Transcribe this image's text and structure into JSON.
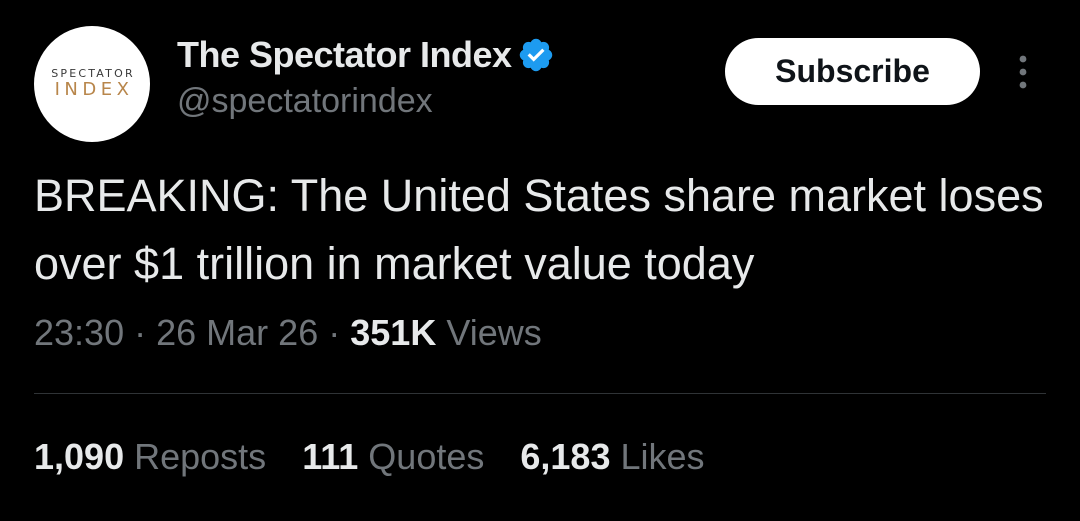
{
  "profile": {
    "avatar_line1": "SPECTATOR",
    "avatar_line2": "INDEX",
    "display_name": "The Spectator Index",
    "handle": "@spectatorindex",
    "verified": true
  },
  "actions": {
    "subscribe_label": "Subscribe",
    "more_icon": "more-vertical-icon"
  },
  "tweet": {
    "text": "BREAKING: The United States share market loses over $1 trillion in market value today",
    "time": "23:30",
    "date": "26 Mar 26",
    "separator": "·",
    "views_count": "351K",
    "views_label": "Views"
  },
  "stats": [
    {
      "count": "1,090",
      "label": "Reposts"
    },
    {
      "count": "111",
      "label": "Quotes"
    },
    {
      "count": "6,183",
      "label": "Likes"
    }
  ],
  "colors": {
    "background": "#000000",
    "primary_text": "#e7e9ea",
    "secondary_text": "#71767b",
    "verified_badge": "#1d9bf0",
    "divider": "#2f3336",
    "avatar_accent": "#b8864b"
  }
}
